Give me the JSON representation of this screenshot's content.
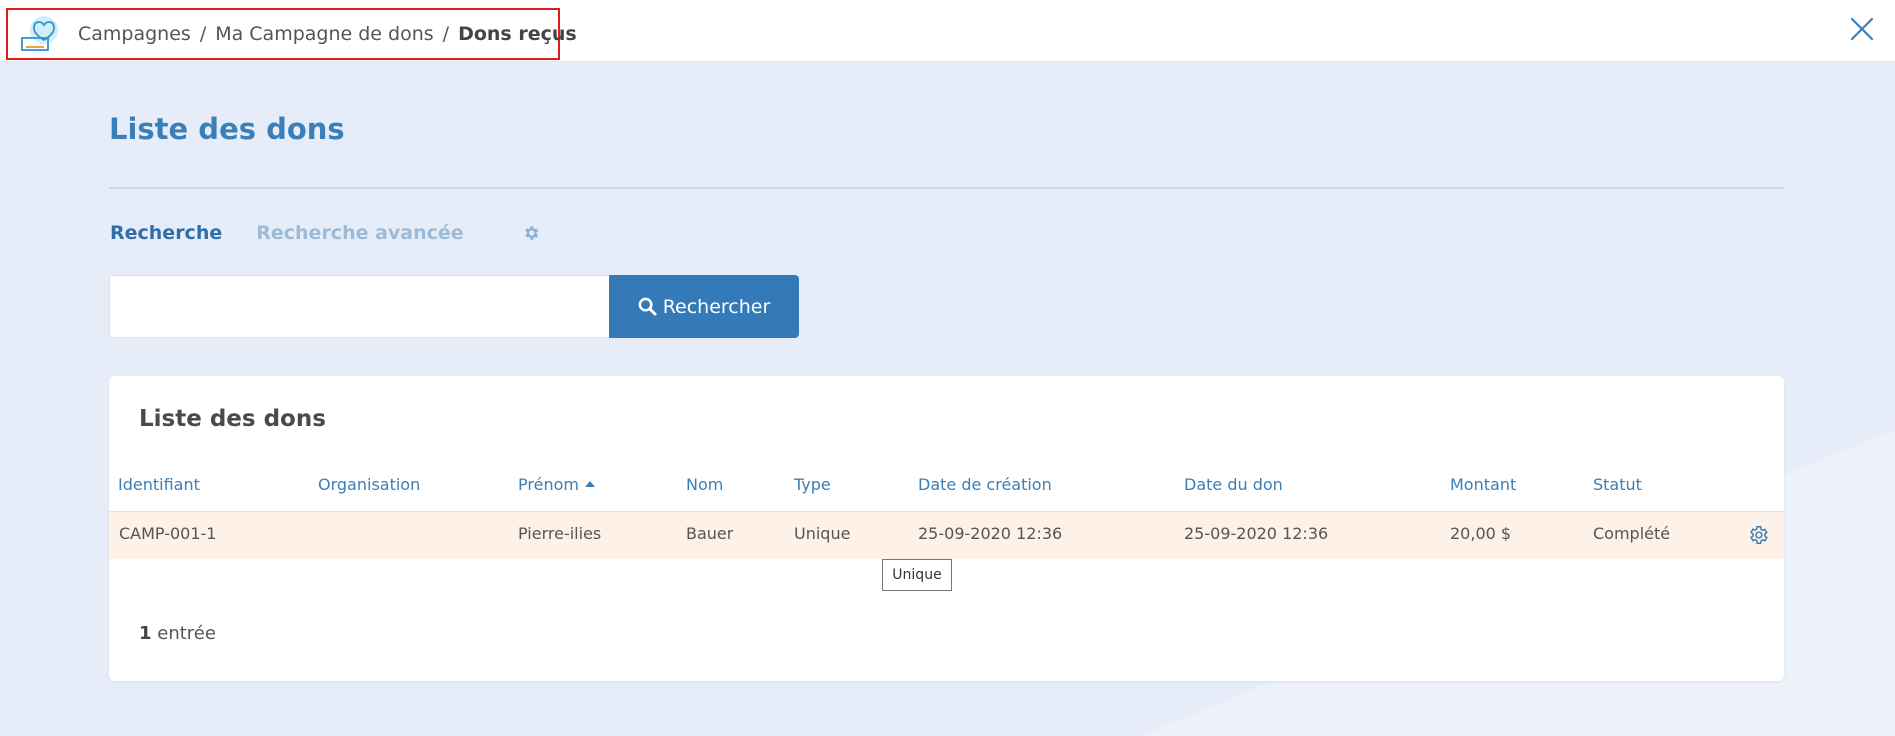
{
  "breadcrumb": {
    "items": [
      "Campagnes",
      "Ma Campagne de dons"
    ],
    "separator": "/",
    "current": "Dons reçus"
  },
  "header": {
    "logo_icon": "donation-heart-box-icon",
    "close_icon": "close-icon"
  },
  "page": {
    "title": "Liste des dons"
  },
  "tabs": {
    "active": "Recherche",
    "inactive": "Recherche avancée",
    "settings_icon": "gear-icon"
  },
  "search": {
    "value": "",
    "placeholder": "",
    "button_label": "Rechercher",
    "button_icon": "search-icon"
  },
  "table": {
    "title": "Liste des dons",
    "columns": [
      "Identifiant",
      "Organisation",
      "Prénom",
      "Nom",
      "Type",
      "Date de création",
      "Date du don",
      "Montant",
      "Statut"
    ],
    "sorted_column": "Prénom",
    "rows": [
      {
        "identifiant": "CAMP-001-1",
        "organisation": "",
        "prenom": "Pierre-ilies",
        "nom": "Bauer",
        "type": "Unique",
        "date_creation": "25-09-2020 12:36",
        "date_don": "25-09-2020 12:36",
        "montant": "20,00 $",
        "statut": "Complété"
      }
    ],
    "tooltip": "Unique",
    "count_number": "1",
    "count_label": "entrée"
  },
  "colors": {
    "accent": "#3a7fb8",
    "button": "#347ab8",
    "row_highlight": "#fdf1e8",
    "background": "#e7edf8",
    "highlight_box": "#e01b1b"
  }
}
